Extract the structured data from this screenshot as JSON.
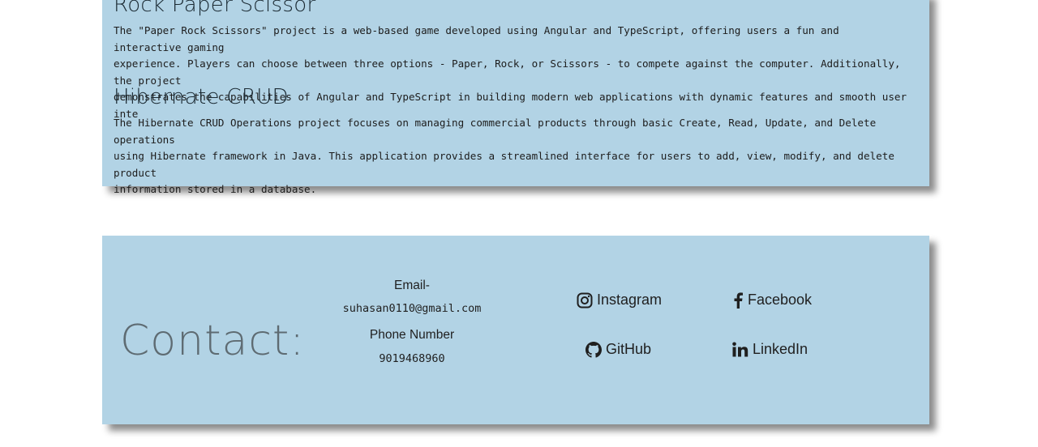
{
  "projects": [
    {
      "title": "Rock Paper Scissor",
      "description": "The \"Paper Rock Scissors\" project is a web-based game developed using Angular and TypeScript, offering users a fun and interactive gaming\nexperience. Players can choose between three options - Paper, Rock, or Scissors - to compete against the computer. Additionally, the project\ndemonstrates the capabilities of Angular and TypeScript in building modern web applications with dynamic features and smooth user inte"
    },
    {
      "title": "Hibernate CRUD",
      "description": "The Hibernate CRUD Operations project focuses on managing commercial products through basic Create, Read, Update, and Delete operations\nusing Hibernate framework in Java. This application provides a streamlined interface for users to add, view, modify, and delete product\ninformation stored in a database."
    }
  ],
  "contact": {
    "title": "Contact:",
    "email_label": "Email-",
    "email": "suhasan0110@gmail.com",
    "phone_label": "Phone Number",
    "phone": "9019468960",
    "links": {
      "instagram": {
        "label": "Instagram",
        "icon": "instagram-icon"
      },
      "facebook": {
        "label": "Facebook",
        "icon": "facebook-icon"
      },
      "github": {
        "label": "GitHub",
        "icon": "github-icon"
      },
      "linkedin": {
        "label": "LinkedIn",
        "icon": "linkedin-icon"
      }
    }
  },
  "colors": {
    "card_background": "#b2d3e5",
    "contact_title": "#5e6b72",
    "text": "#1f1f1f"
  }
}
